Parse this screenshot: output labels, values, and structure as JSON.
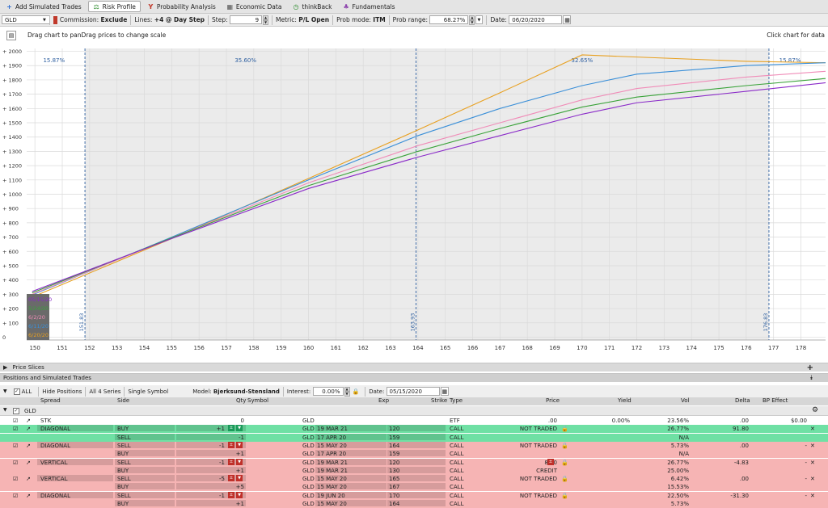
{
  "tabs": [
    {
      "icon": "plus-icon",
      "label": "Add Simulated Trades"
    },
    {
      "icon": "risk-profile-icon",
      "label": "Risk Profile"
    },
    {
      "icon": "probability-icon",
      "label": "Probability Analysis"
    },
    {
      "icon": "economic-data-icon",
      "label": "Economic Data"
    },
    {
      "icon": "thinkback-icon",
      "label": "thinkBack"
    },
    {
      "icon": "fundamentals-icon",
      "label": "Fundamentals"
    }
  ],
  "toolbar": {
    "symbol": "GLD",
    "commission_label": "Commission:",
    "commission_value": "Exclude",
    "lines_label": "Lines:",
    "lines_value": "+4 @ Day Step",
    "step_label": "Step:",
    "step_value": "9",
    "metric_label": "Metric:",
    "metric_value": "P/L Open",
    "probmode_label": "Prob mode:",
    "probmode_value": "ITM",
    "probrange_label": "Prob range:",
    "probrange_value": "68.27%",
    "date_label": "Date:",
    "date_value": "06/20/2020"
  },
  "hint": {
    "left": "Drag chart to panDrag prices to change scale",
    "right": "Click chart for data"
  },
  "chart_data": {
    "type": "line",
    "xlim": [
      149.7,
      178.9
    ],
    "ylim": [
      -20,
      2020
    ],
    "x_ticks": [
      150,
      151,
      152,
      153,
      154,
      155,
      156,
      157,
      158,
      159,
      160,
      161,
      162,
      163,
      164,
      165,
      166,
      167,
      168,
      169,
      170,
      171,
      172,
      173,
      174,
      175,
      176,
      177,
      178
    ],
    "y_ticks": [
      0,
      100,
      200,
      300,
      400,
      500,
      600,
      700,
      800,
      900,
      1000,
      1100,
      1200,
      1300,
      1400,
      1500,
      1600,
      1700,
      1800,
      1900,
      2000
    ],
    "y_tick_labels": [
      "0",
      "+ 100",
      "+ 200",
      "+ 300",
      "+ 400",
      "+ 500",
      "+ 600",
      "+ 700",
      "+ 800",
      "+ 900",
      "+ 1000",
      "+ 1100",
      "+ 1200",
      "+ 1300",
      "+ 1400",
      "+ 1500",
      "+ 1600",
      "+ 1700",
      "+ 1800",
      "+ 1900",
      "+ 2000"
    ],
    "vlines": [
      {
        "x": 151.83,
        "label": "151.83"
      },
      {
        "x": 163.93,
        "label": "163.93"
      },
      {
        "x": 176.83,
        "label": "176.83"
      }
    ],
    "shade_range": [
      151.83,
      176.83
    ],
    "prob_labels": [
      {
        "x": 150.7,
        "text": "15.87%"
      },
      {
        "x": 157.7,
        "text": "35.60%"
      },
      {
        "x": 170.0,
        "text": "32.65%"
      },
      {
        "x": 177.6,
        "text": "15.87%"
      }
    ],
    "date_box": [
      "05/15/20",
      "5/24/20",
      "6/2/20",
      "6/11/20",
      "6/20/20"
    ],
    "series": [
      {
        "color": "#e8a020",
        "x": [
          149.9,
          155,
          160,
          164,
          167,
          170,
          172,
          176,
          178.9
        ],
        "y": [
          280,
          690,
          1110,
          1450,
          1710,
          1975,
          1960,
          1930,
          1920
        ]
      },
      {
        "color": "#3a8fd8",
        "x": [
          149.9,
          155,
          160,
          164,
          167,
          170,
          172,
          176,
          178.9
        ],
        "y": [
          295,
          700,
          1100,
          1410,
          1600,
          1760,
          1840,
          1900,
          1920
        ]
      },
      {
        "color": "#f08cb8",
        "x": [
          149.9,
          155,
          160,
          164,
          167,
          170,
          172,
          176,
          178.9
        ],
        "y": [
          300,
          695,
          1080,
          1340,
          1500,
          1660,
          1740,
          1820,
          1860
        ]
      },
      {
        "color": "#3aa33a",
        "x": [
          149.9,
          155,
          160,
          164,
          167,
          170,
          172,
          176,
          178.9
        ],
        "y": [
          310,
          695,
          1060,
          1300,
          1460,
          1610,
          1680,
          1760,
          1810
        ]
      },
      {
        "color": "#8a2ac8",
        "x": [
          149.9,
          155,
          160,
          164,
          167,
          170,
          172,
          176,
          178.9
        ],
        "y": [
          320,
          690,
          1040,
          1260,
          1410,
          1560,
          1640,
          1720,
          1780
        ]
      }
    ]
  },
  "sections": {
    "price_slices": "Price Slices",
    "positions": "Positions and Simulated Trades"
  },
  "positions_toolbar": {
    "all": "ALL",
    "hide": "Hide Positions",
    "series": "All 4 Series",
    "single": "Single Symbol",
    "model_label": "Model:",
    "model_value": "Bjerksund-Stensland",
    "interest_label": "Interest:",
    "interest_value": "0.00%",
    "date_label": "Date:",
    "date_value": "05/15/2020"
  },
  "table_headers": {
    "spread": "Spread",
    "side": "Side",
    "qty": "Qty",
    "symbol": "Symbol",
    "exp": "Exp",
    "strike": "Strike",
    "type": "Type",
    "price": "Price",
    "yield": "Yield",
    "vol": "Vol",
    "delta": "Delta",
    "bp": "BP Effect"
  },
  "group": "GLD",
  "rows": [
    {
      "color": "white",
      "spread": "STK",
      "side": "",
      "qty": "0",
      "symbol": "GLD",
      "exp": "",
      "strike": "",
      "type": "ETF",
      "price": ".00",
      "yield": "0.00%",
      "vol": "23.56%",
      "delta": ".00",
      "bp": "$0.00"
    },
    {
      "color": "green",
      "spread": "DIAGONAL",
      "side": "BUY",
      "qty": "+1",
      "symbol": "GLD",
      "exp": "19 MAR 21",
      "strike": "120",
      "type": "CALL",
      "price": "NOT TRADED",
      "yield": "",
      "vol": "26.77%",
      "delta": "91.80",
      "bp": ""
    },
    {
      "color": "green",
      "spread": "",
      "side": "SELL",
      "qty": "-1",
      "symbol": "GLD",
      "exp": "17 APR 20",
      "strike": "159",
      "type": "CALL",
      "price": "",
      "yield": "",
      "vol": "N/A",
      "delta": "",
      "bp": ""
    },
    {
      "color": "pink",
      "spread": "DIAGONAL",
      "side": "SELL",
      "qty": "-1",
      "symbol": "GLD",
      "exp": "15 MAY 20",
      "strike": "164",
      "type": "CALL",
      "price": "NOT TRADED",
      "yield": "",
      "vol": "5.73%",
      "delta": ".00",
      "bp": "-"
    },
    {
      "color": "pink",
      "spread": "",
      "side": "BUY",
      "qty": "+1",
      "symbol": "GLD",
      "exp": "17 APR 20",
      "strike": "159",
      "type": "CALL",
      "price": "",
      "yield": "",
      "vol": "N/A",
      "delta": "",
      "bp": ""
    },
    {
      "color": "pink",
      "spread": "VERTICAL",
      "side": "SELL",
      "qty": "-1",
      "symbol": "GLD",
      "exp": "19 MAR 21",
      "strike": "120",
      "type": "CALL",
      "price": "8.60",
      "yield": "",
      "vol": "26.77%",
      "delta": "-4.83",
      "bp": "-"
    },
    {
      "color": "pink",
      "spread": "",
      "side": "BUY",
      "qty": "+1",
      "symbol": "GLD",
      "exp": "19 MAR 21",
      "strike": "130",
      "type": "CALL",
      "price": "CREDIT",
      "yield": "",
      "vol": "25.00%",
      "delta": "",
      "bp": ""
    },
    {
      "color": "pink",
      "spread": "VERTICAL",
      "side": "SELL",
      "qty": "-5",
      "symbol": "GLD",
      "exp": "15 MAY 20",
      "strike": "165",
      "type": "CALL",
      "price": "NOT TRADED",
      "yield": "",
      "vol": "6.42%",
      "delta": ".00",
      "bp": "-"
    },
    {
      "color": "pink",
      "spread": "",
      "side": "BUY",
      "qty": "+5",
      "symbol": "GLD",
      "exp": "15 MAY 20",
      "strike": "167",
      "type": "CALL",
      "price": "",
      "yield": "",
      "vol": "15.53%",
      "delta": "",
      "bp": ""
    },
    {
      "color": "pink",
      "spread": "DIAGONAL",
      "side": "SELL",
      "qty": "-1",
      "symbol": "GLD",
      "exp": "19 JUN 20",
      "strike": "170",
      "type": "CALL",
      "price": "NOT TRADED",
      "yield": "",
      "vol": "22.50%",
      "delta": "-31.30",
      "bp": "-"
    },
    {
      "color": "pink",
      "spread": "",
      "side": "BUY",
      "qty": "+1",
      "symbol": "GLD",
      "exp": "15 MAY 20",
      "strike": "164",
      "type": "CALL",
      "price": "",
      "yield": "",
      "vol": "5.73%",
      "delta": "",
      "bp": ""
    }
  ]
}
